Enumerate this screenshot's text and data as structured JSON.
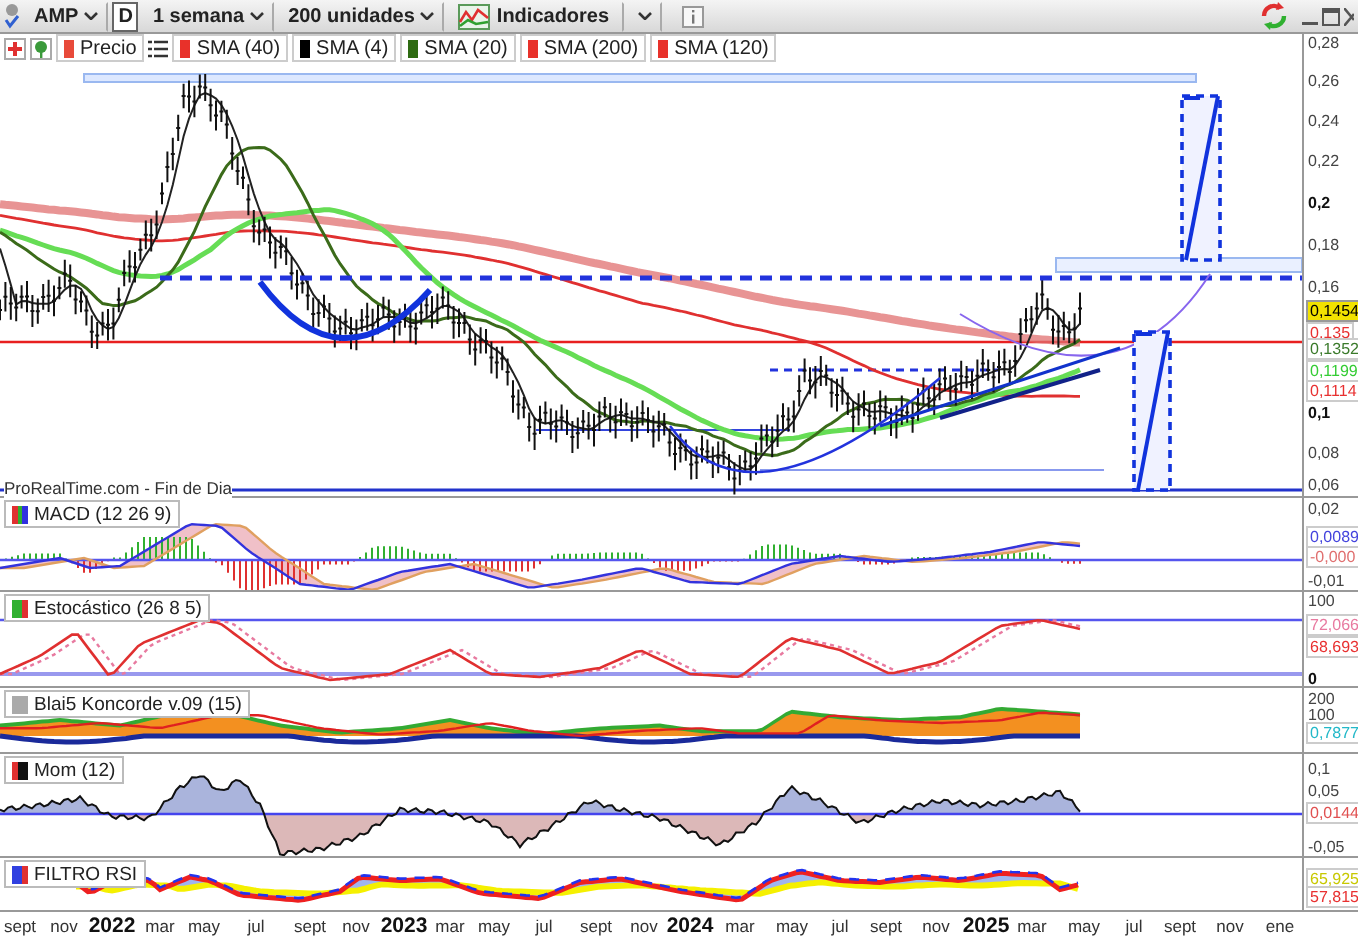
{
  "toolbar": {
    "symbol": "AMP",
    "period": "D",
    "timeframe": "1 semana",
    "units": "200 unidades",
    "indicators": "Indicadores"
  },
  "legend": [
    {
      "label": "Precio",
      "color": "#e84a3a"
    },
    {
      "label": "SMA (40)",
      "color": "#e8312a"
    },
    {
      "label": "SMA (4)",
      "color": "#000000"
    },
    {
      "label": "SMA (20)",
      "color": "#2e6b12"
    },
    {
      "label": "SMA (200)",
      "color": "#e8312a"
    },
    {
      "label": "SMA (120)",
      "color": "#e8312a"
    }
  ],
  "price_chart": {
    "source": "ProRealTime.com - Fin de Dia",
    "axis_labels": [
      {
        "text": "0,28",
        "kind": "tick"
      },
      {
        "text": "0,26",
        "kind": "tick"
      },
      {
        "text": "0,24",
        "kind": "tick"
      },
      {
        "text": "0,22",
        "kind": "tick"
      },
      {
        "text": "0,2",
        "kind": "major"
      },
      {
        "text": "0,18",
        "kind": "tick"
      },
      {
        "text": "0,16",
        "kind": "tick"
      },
      {
        "text": "0,1454",
        "kind": "last",
        "color": "#f2e200"
      },
      {
        "text": "0,135",
        "kind": "level",
        "color": "#e83030"
      },
      {
        "text": "0,1352",
        "kind": "level",
        "color": "#3a7a2a"
      },
      {
        "text": "0,1199",
        "kind": "level",
        "color": "#33cc33"
      },
      {
        "text": "0,1114",
        "kind": "level",
        "color": "#e83030"
      },
      {
        "text": "0,1",
        "kind": "major"
      },
      {
        "text": "0,08",
        "kind": "tick"
      },
      {
        "text": "0,06",
        "kind": "tick"
      }
    ]
  },
  "panels": [
    {
      "kind": "macd",
      "title": "MACD (12 26 9)",
      "axis_labels": [
        {
          "text": "0,02",
          "kind": "tick"
        },
        {
          "text": "0,0089",
          "kind": "level",
          "color": "#4444dd"
        },
        {
          "text": "-0,000",
          "kind": "level",
          "color": "#e07070"
        },
        {
          "text": "-0,01",
          "kind": "tick"
        }
      ]
    },
    {
      "kind": "stochastic",
      "title": "Estocástico (26 8 5)",
      "axis_labels": [
        {
          "text": "100",
          "kind": "tick"
        },
        {
          "text": "72,066",
          "kind": "level",
          "color": "#e87aa0"
        },
        {
          "text": "68,693",
          "kind": "level",
          "color": "#e83030"
        },
        {
          "text": "0",
          "kind": "major"
        }
      ]
    },
    {
      "kind": "koncorde",
      "title": "Blai5 Koncorde v.09 (15)",
      "axis_labels": [
        {
          "text": "200",
          "kind": "tick"
        },
        {
          "text": "100",
          "kind": "tick"
        },
        {
          "text": "0,7877",
          "kind": "level",
          "color": "#22b8c8"
        }
      ]
    },
    {
      "kind": "momentum",
      "title": "Mom (12)",
      "axis_labels": [
        {
          "text": "0,1",
          "kind": "tick"
        },
        {
          "text": "0,05",
          "kind": "tick"
        },
        {
          "text": "0,0144",
          "kind": "level",
          "color": "#e05050"
        },
        {
          "text": "-0,05",
          "kind": "tick"
        }
      ]
    },
    {
      "kind": "rsi",
      "title": "FILTRO RSI",
      "axis_labels": [
        {
          "text": "65,925",
          "kind": "level",
          "color": "#c8c800"
        },
        {
          "text": "57,815",
          "kind": "level",
          "color": "#e83030"
        }
      ]
    }
  ],
  "time_axis": [
    {
      "text": "sept",
      "kind": "month"
    },
    {
      "text": "nov",
      "kind": "month"
    },
    {
      "text": "2022",
      "kind": "year"
    },
    {
      "text": "mar",
      "kind": "month"
    },
    {
      "text": "may",
      "kind": "month"
    },
    {
      "text": "jul",
      "kind": "month"
    },
    {
      "text": "sept",
      "kind": "month"
    },
    {
      "text": "nov",
      "kind": "month"
    },
    {
      "text": "2023",
      "kind": "year"
    },
    {
      "text": "mar",
      "kind": "month"
    },
    {
      "text": "may",
      "kind": "month"
    },
    {
      "text": "jul",
      "kind": "month"
    },
    {
      "text": "sept",
      "kind": "month"
    },
    {
      "text": "nov",
      "kind": "month"
    },
    {
      "text": "2024",
      "kind": "year"
    },
    {
      "text": "mar",
      "kind": "month"
    },
    {
      "text": "may",
      "kind": "month"
    },
    {
      "text": "jul",
      "kind": "month"
    },
    {
      "text": "sept",
      "kind": "month"
    },
    {
      "text": "nov",
      "kind": "month"
    },
    {
      "text": "2025",
      "kind": "year"
    },
    {
      "text": "mar",
      "kind": "month"
    },
    {
      "text": "may",
      "kind": "month"
    },
    {
      "text": "jul",
      "kind": "month"
    },
    {
      "text": "sept",
      "kind": "month"
    },
    {
      "text": "nov",
      "kind": "month"
    },
    {
      "text": "ene",
      "kind": "month"
    }
  ]
}
